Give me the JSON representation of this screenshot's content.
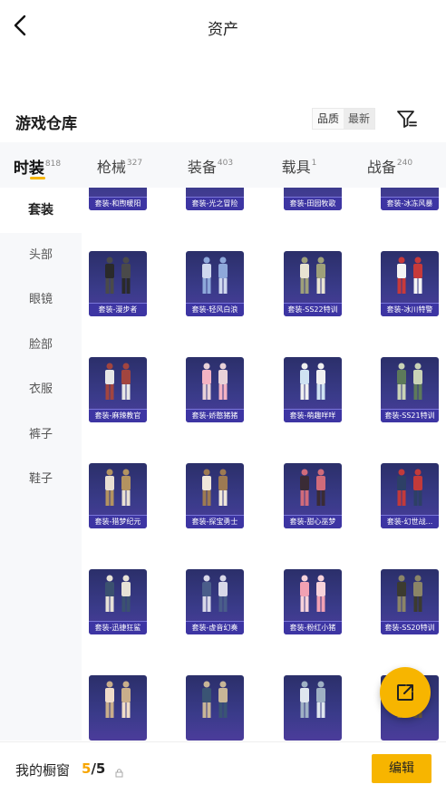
{
  "header": {
    "title": "资产",
    "back_icon": "chevron-left-icon"
  },
  "section": {
    "title": "游戏仓库",
    "sort_options": [
      "品质",
      "最新"
    ],
    "sort_selected": "最新",
    "filter_icon": "filter-icon"
  },
  "tabs": [
    {
      "label": "时装",
      "count": "818",
      "active": true
    },
    {
      "label": "枪械",
      "count": "327",
      "active": false
    },
    {
      "label": "装备",
      "count": "403",
      "active": false
    },
    {
      "label": "载具",
      "count": "1",
      "active": false
    },
    {
      "label": "战备",
      "count": "240",
      "active": false
    }
  ],
  "sidebar": {
    "items": [
      {
        "label": "套装",
        "active": true
      },
      {
        "label": "头部",
        "active": false
      },
      {
        "label": "眼镜",
        "active": false
      },
      {
        "label": "脸部",
        "active": false
      },
      {
        "label": "衣服",
        "active": false
      },
      {
        "label": "裤子",
        "active": false
      },
      {
        "label": "鞋子",
        "active": false
      }
    ]
  },
  "items": [
    "套装-和煦暖阳",
    "套装-光之冒险",
    "套装-田园牧歌",
    "套装-冰冻风暴",
    "套装-漫步者",
    "套装-轻风白浪",
    "套装-SS22特训",
    "套装-冰川特警",
    "套装-麻辣教官",
    "套装-娇憨猪猪",
    "套装-萌趣咩咩",
    "套装-SS21特训",
    "套装-猎梦纪元",
    "套装-探宝勇士",
    "套装-甜心巫梦",
    "套装-幻世战...",
    "套装-迅捷狂鲨",
    "套装-虚音幻奏",
    "套装-粉红小猪",
    "套装-SS20特训",
    "",
    "",
    "",
    ""
  ],
  "colors": {
    "accent": "#f7b500",
    "card_bg": "#2b2f6a",
    "card_caption": "#3d35a3"
  },
  "fab": {
    "icon": "share-external-icon"
  },
  "footer": {
    "label": "我的橱窗",
    "current": "5",
    "separator": "/",
    "total": "5",
    "lock_icon": "lock-icon",
    "edit_label": "编辑"
  }
}
